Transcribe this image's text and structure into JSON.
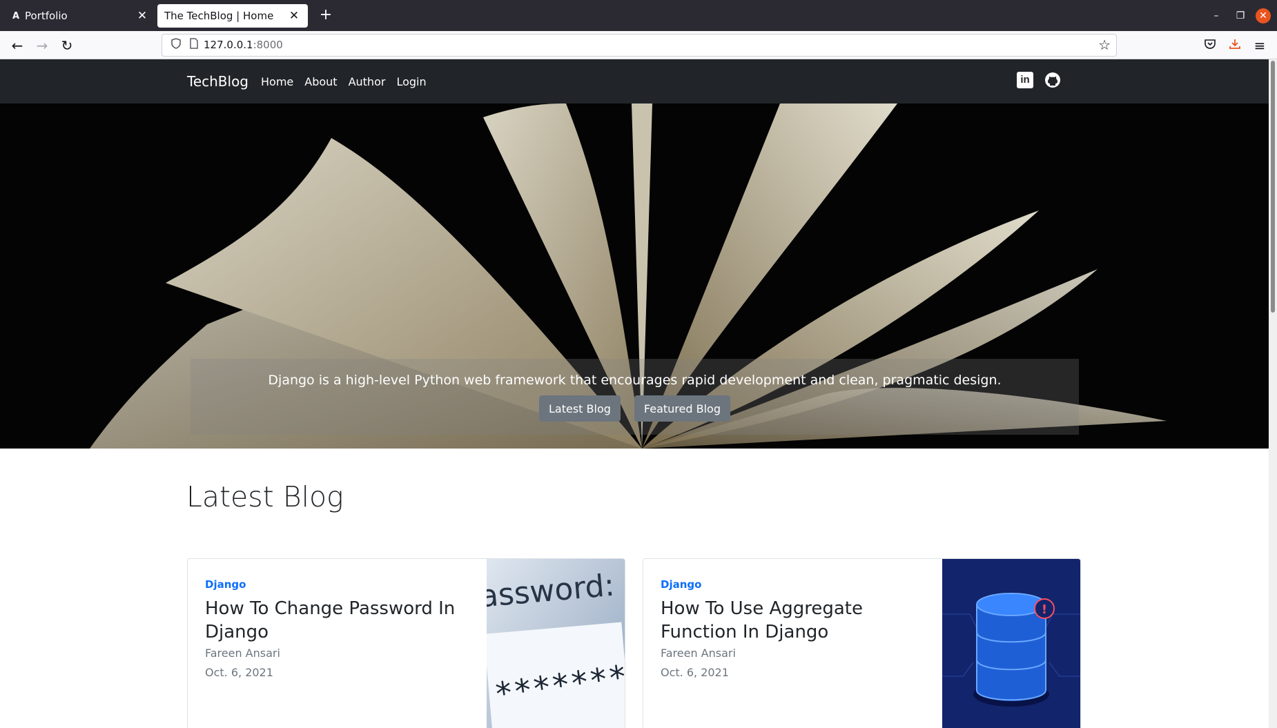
{
  "browser": {
    "tabs": [
      {
        "label": "Portfolio",
        "favicon": "A"
      },
      {
        "label": "The TechBlog | Home"
      }
    ],
    "url_host": "127.0.0.1",
    "url_port": ":8000"
  },
  "site": {
    "brand": "TechBlog",
    "menu": [
      "Home",
      "About",
      "Author",
      "Login"
    ],
    "social": [
      "linkedin-icon",
      "github-icon"
    ],
    "linkedin_glyph": "in"
  },
  "hero": {
    "caption": "Django is a high-level Python web framework that encourages rapid development and clean, pragmatic design.",
    "buttons": [
      "Latest Blog",
      "Featured Blog"
    ]
  },
  "latest": {
    "heading": "Latest Blog",
    "posts": [
      {
        "category": "Django",
        "title": "How To Change Password In Django",
        "author": "Fareen Ansari",
        "date": "Oct. 6, 2021",
        "thumb_text": "assword:",
        "thumb_mask": "*********"
      },
      {
        "category": "Django",
        "title": "How To Use Aggregate Function In Django",
        "author": "Fareen Ansari",
        "date": "Oct. 6, 2021"
      }
    ]
  },
  "colors": {
    "accent": "#0d6efd",
    "nav": "#212529",
    "button": "#6c757d"
  }
}
